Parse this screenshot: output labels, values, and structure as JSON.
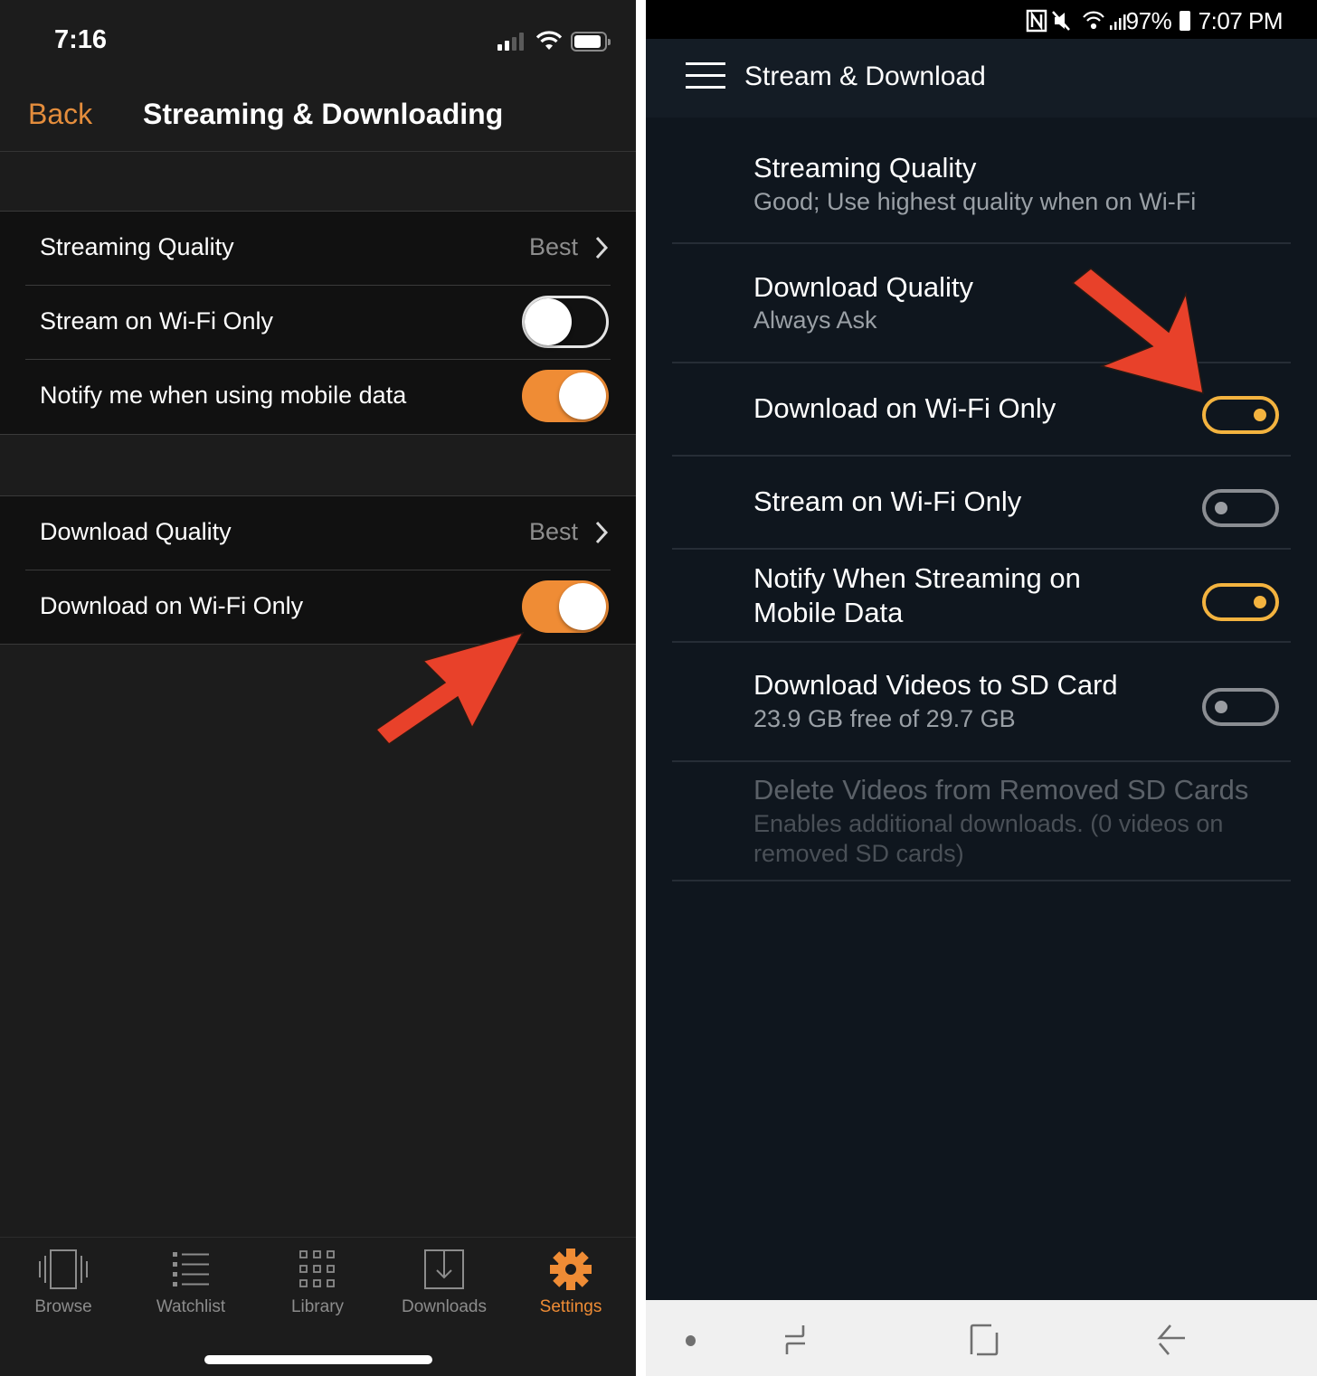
{
  "ios": {
    "status_bar": {
      "time": "7:16",
      "icons": [
        "cellular-signal-icon",
        "wifi-icon",
        "battery-icon"
      ]
    },
    "nav": {
      "back_label": "Back",
      "title": "Streaming & Downloading"
    },
    "groups": [
      {
        "rows": [
          {
            "label": "Streaming Quality",
            "type": "disclosure",
            "value": "Best"
          },
          {
            "label": "Stream on Wi-Fi Only",
            "type": "toggle",
            "on": false
          },
          {
            "label": "Notify me when using mobile data",
            "type": "toggle",
            "on": true
          }
        ]
      },
      {
        "rows": [
          {
            "label": "Download Quality",
            "type": "disclosure",
            "value": "Best"
          },
          {
            "label": "Download on Wi-Fi Only",
            "type": "toggle",
            "on": true
          }
        ]
      }
    ],
    "tabbar": [
      {
        "label": "Browse",
        "icon": "browse-icon",
        "active": false
      },
      {
        "label": "Watchlist",
        "icon": "watchlist-icon",
        "active": false
      },
      {
        "label": "Library",
        "icon": "library-grid-icon",
        "active": false
      },
      {
        "label": "Downloads",
        "icon": "download-icon",
        "active": false
      },
      {
        "label": "Settings",
        "icon": "gear-icon",
        "active": true
      }
    ],
    "colors": {
      "accent": "#ef8c35",
      "background": "#1c1c1c",
      "group_background": "#111111"
    }
  },
  "android": {
    "status_bar": {
      "battery": "97%",
      "time": "7:07 PM",
      "icons": [
        "nfc-icon",
        "mute-icon",
        "wifi-icon",
        "cellular-signal-icon",
        "battery-icon"
      ]
    },
    "appbar": {
      "title": "Stream & Download"
    },
    "items": [
      {
        "title": "Streaming Quality",
        "subtitle": "Good; Use highest quality when on Wi-Fi",
        "type": "text"
      },
      {
        "title": "Download Quality",
        "subtitle": "Always Ask",
        "type": "text"
      },
      {
        "title": "Download on Wi-Fi Only",
        "type": "toggle",
        "on": true
      },
      {
        "title": "Stream on Wi-Fi Only",
        "type": "toggle",
        "on": false
      },
      {
        "title": "Notify When Streaming on Mobile Data",
        "type": "toggle",
        "on": true
      },
      {
        "title": "Download Videos to SD Card",
        "subtitle": "23.9 GB free of 29.7 GB",
        "type": "toggle",
        "on": false
      },
      {
        "title": "Delete Videos from Removed SD Cards",
        "subtitle": "Enables additional downloads. (0 videos on removed SD cards)",
        "type": "text",
        "disabled": true
      }
    ],
    "navbar": [
      "dot-icon",
      "recents-icon",
      "home-icon",
      "back-icon"
    ],
    "colors": {
      "accent": "#f3b33f",
      "background": "#0f161e",
      "appbar": "#141c25"
    }
  },
  "annotations": {
    "arrow_color": "#e8412a"
  }
}
